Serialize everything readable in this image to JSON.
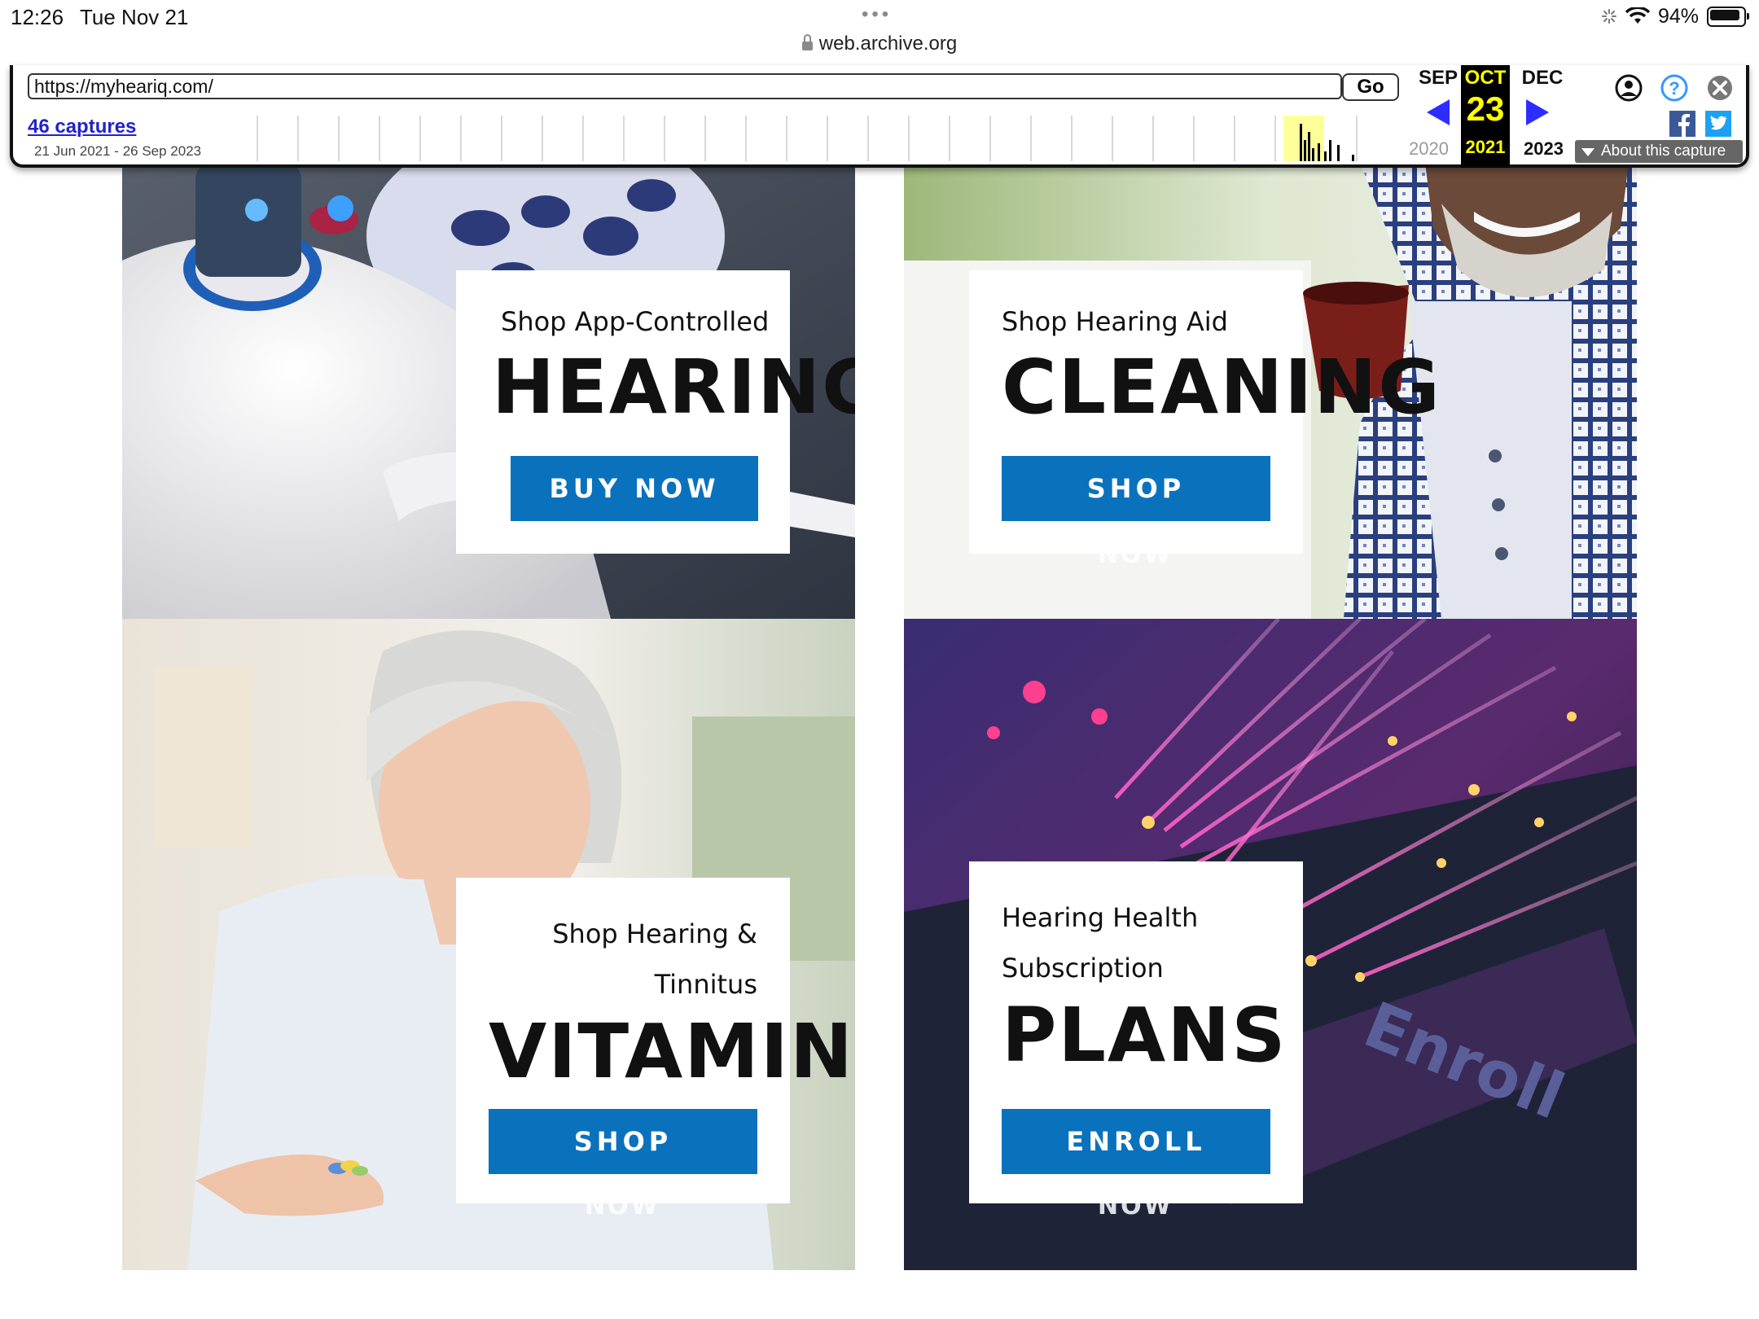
{
  "status_bar": {
    "time": "12:26",
    "date": "Tue Nov 21",
    "tab_dots": "•••",
    "url": "web.archive.org",
    "battery_text": "94%"
  },
  "wayback": {
    "url_value": "https://myheariq.com/",
    "go_label": "Go",
    "captures_label": "46 captures",
    "captures_range": "21 Jun 2021 - 26 Sep 2023",
    "prev_month": "SEP",
    "current_month": "OCT",
    "current_day": "23",
    "current_year": "2021",
    "next_month": "DEC",
    "prev_year": "2020",
    "next_year": "2023",
    "about_label": "About this capture",
    "accent_color": "#ffff00",
    "link_color": "#2222cc"
  },
  "tiles": {
    "hearing": {
      "pre_line1": "Shop App-Controlled",
      "title": "HEARING",
      "button": "BUY NOW"
    },
    "cleaning": {
      "pre_line1": "Shop Hearing Aid",
      "title": "CLEANING",
      "button": "SHOP",
      "ghost": "NOW"
    },
    "vitamins": {
      "pre_line1": "Shop Hearing &",
      "pre_line2": "Tinnitus",
      "title": "VITAMINS",
      "button": "SHOP",
      "ghost": "NOW"
    },
    "plans": {
      "pre_line1": "Hearing Health",
      "pre_line2": "Subscription",
      "title": "PLANS",
      "button": "ENROLL",
      "ghost": "NOW",
      "keyboard_key": "Enroll"
    }
  },
  "colors": {
    "cta_blue": "#0a72bd"
  }
}
